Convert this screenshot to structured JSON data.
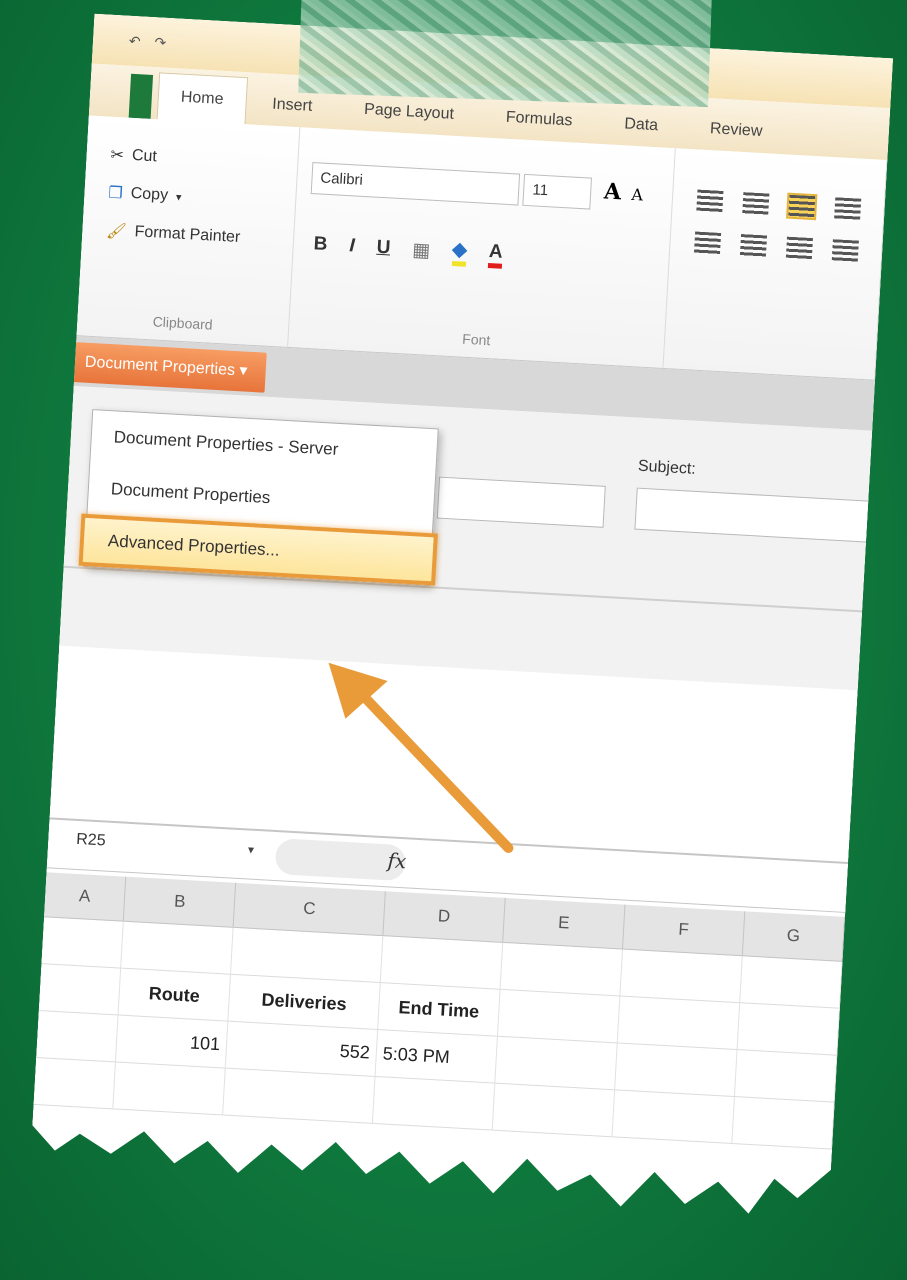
{
  "quick_access": {
    "undo": "↶",
    "redo": "↷"
  },
  "ribbon": {
    "tabs": [
      "Home",
      "Insert",
      "Page Layout",
      "Formulas",
      "Data",
      "Review"
    ],
    "clipboard": {
      "cut": "Cut",
      "copy": "Copy",
      "format_painter": "Format Painter",
      "label": "Clipboard"
    },
    "font": {
      "name": "Calibri",
      "size": "11",
      "grow": "A",
      "shrink": "A",
      "bold": "B",
      "italic": "I",
      "underline": "U",
      "label": "Font"
    }
  },
  "document_properties": {
    "button_label": "Document Properties",
    "subject_label": "Subject:",
    "menu": {
      "items": [
        "Document Properties - Server",
        "Document Properties",
        "Advanced Properties..."
      ],
      "highlighted_index": 2
    }
  },
  "formula_bar": {
    "name_box": "R25",
    "fx": "fx"
  },
  "sheet": {
    "columns": [
      "A",
      "B",
      "C",
      "D",
      "E",
      "F",
      "G"
    ],
    "headers": {
      "route": "Route",
      "deliveries": "Deliveries",
      "end_time": "End Time"
    },
    "row1": {
      "route": "101",
      "deliveries": "552",
      "end_time": "5:03 PM"
    }
  },
  "colors": {
    "background": "#0f7a3e",
    "highlight": "#e99b39",
    "doc_button": "#e7743a"
  }
}
